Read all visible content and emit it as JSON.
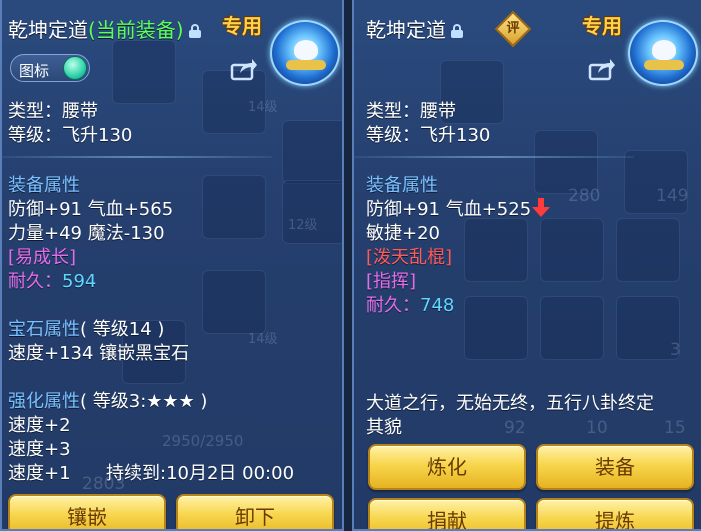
{
  "left_panel": {
    "title": "乾坤定道",
    "current_tag": "(当前装备)",
    "exclusive_badge": "专用",
    "icon_toggle_label": "图标",
    "type_line": "类型：腰带",
    "level_line": "等级：飞升130",
    "equip_attr_header": "装备属性",
    "attr_line_1": "防御+91 气血+565",
    "attr_line_2": "力量+49 魔法-130",
    "special_effect": "[易成长]",
    "durability_label": "耐久：",
    "durability_value": "594",
    "gem_header": "宝石属性",
    "gem_level": "( 等级14 )",
    "gem_line": "速度+134 镶嵌黑宝石",
    "enhance_header": "强化属性",
    "enhance_level": "( 等级3:★★★ )",
    "enhance_line_1": "速度+2",
    "enhance_line_2": "速度+3",
    "enhance_line_3": "速度+1",
    "enhance_duration": "持续到:10月2日 00:00",
    "buttons": {
      "inlay": "镶嵌",
      "unequip": "卸下"
    },
    "bg_numbers": [
      "14级",
      "12级",
      "14级",
      "2950/2950",
      "2803"
    ]
  },
  "right_panel": {
    "title": "乾坤定道",
    "rate_badge": "评",
    "exclusive_badge": "专用",
    "type_line": "类型：腰带",
    "level_line": "等级：飞升130",
    "equip_attr_header": "装备属性",
    "attr_line_1": "防御+91 气血+525",
    "attr_line_2": "敏捷+20",
    "special_effect": "[泼天乱棍]",
    "special_skill": "[指挥]",
    "durability_label": "耐久：",
    "durability_value": "748",
    "description_line_1": "大道之行，无始无终，五行八卦终定",
    "description_line_2": "其貌",
    "buttons": {
      "refine": "炼化",
      "equip": "装备",
      "donate": "捐献",
      "extract": "提炼"
    },
    "bg_numbers": [
      "280",
      "149",
      "92",
      "10",
      "15",
      "3"
    ]
  },
  "colors": {
    "panel_bg": "#253f6e",
    "current_tag": "#5bff5b",
    "section_header": "#79c0ff",
    "special_magenta": "#e56ce8",
    "special_red": "#ff5a5a",
    "durability_value": "#5fd7ff",
    "badge_gold": "#ffd24a",
    "button_gold": "#f7d54c",
    "decrease_arrow": "#ff3b3b"
  },
  "icons": [
    "lock-icon",
    "share-icon",
    "belt-item-icon",
    "toggle-knob",
    "rate-badge-icon",
    "down-arrow-icon"
  ]
}
